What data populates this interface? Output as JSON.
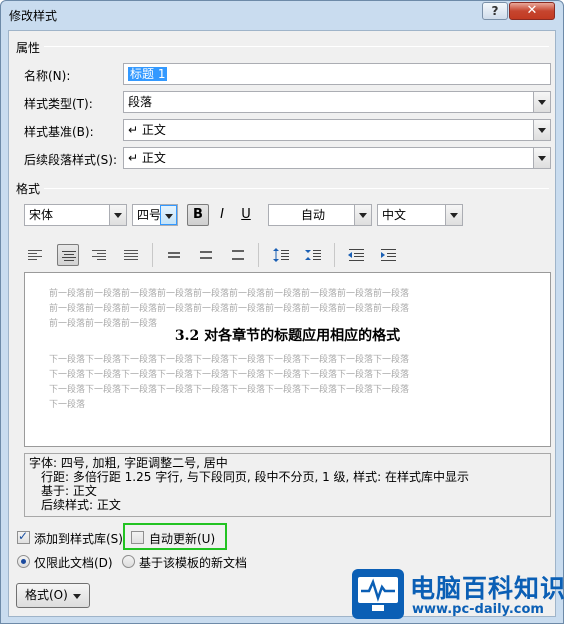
{
  "window": {
    "title": "修改样式",
    "help_label": "?",
    "close_label": "✕"
  },
  "properties": {
    "section_label": "属性",
    "name_label": "名称(N):",
    "name_value": "标题 1",
    "style_type_label": "样式类型(T):",
    "style_type_value": "段落",
    "based_on_label": "样式基准(B):",
    "based_on_value": "↵ 正文",
    "next_style_label": "后续段落样式(S):",
    "next_style_value": "↵ 正文"
  },
  "format": {
    "section_label": "格式",
    "font_value": "宋体",
    "size_value": "四号",
    "bold_label": "B",
    "italic_label": "I",
    "underline_label": "U",
    "color_value": "自动",
    "script_value": "中文"
  },
  "preview": {
    "prev_lines": [
      "前一段落前一段落前一段落前一段落前一段落前一段落前一段落前一段落前一段落前一段落",
      "前一段落前一段落前一段落前一段落前一段落前一段落前一段落前一段落前一段落前一段落",
      "前一段落前一段落前一段落"
    ],
    "heading": "3.2    对各章节的标题应用相应的格式",
    "next_lines": [
      "下一段落下一段落下一段落下一段落下一段落下一段落下一段落下一段落下一段落下一段落",
      "下一段落下一段落下一段落下一段落下一段落下一段落下一段落下一段落下一段落下一段落",
      "下一段落下一段落下一段落下一段落下一段落下一段落下一段落下一段落下一段落下一段落",
      "下一段落"
    ]
  },
  "description": {
    "line1": "字体: 四号, 加粗, 字距调整二号, 居中",
    "line2": "行距: 多倍行距 1.25 字行, 与下段同页, 段中不分页, 1 级, 样式: 在样式库中显示",
    "line3": "基于: 正文",
    "line4": "后续样式: 正文"
  },
  "options": {
    "add_to_gallery_label": "添加到样式库(S)",
    "add_to_gallery_checked": true,
    "auto_update_label": "自动更新(U)",
    "auto_update_checked": false,
    "this_doc_label": "仅限此文档(D)",
    "template_label": "基于该模板的新文档",
    "selected_scope": "仅限此文档(D)"
  },
  "buttons": {
    "format_label": "格式(O)"
  },
  "watermark": {
    "brand": "电脑百科知识",
    "url": "www.pc-daily.com"
  },
  "colors": {
    "highlight": "#3399ff",
    "callout": "#22c322",
    "brand": "#0b5fb5"
  }
}
